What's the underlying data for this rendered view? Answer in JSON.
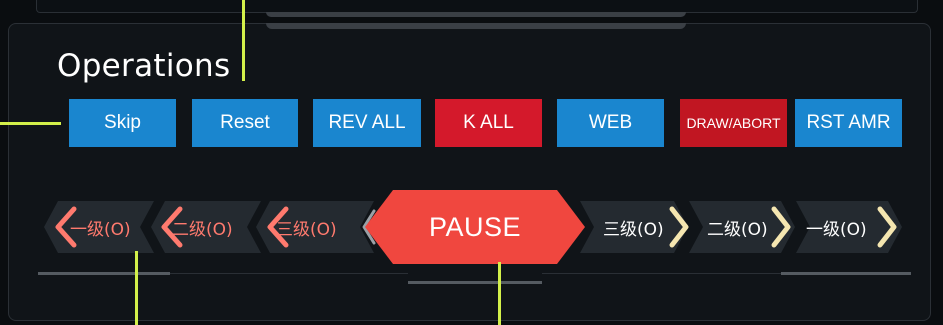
{
  "operations": {
    "title": "Operations",
    "buttons": [
      {
        "label": "Skip",
        "color": "#1a86cf"
      },
      {
        "label": "Reset",
        "color": "#1a86cf"
      },
      {
        "label": "REV ALL",
        "color": "#1a86cf"
      },
      {
        "label": "K ALL",
        "color": "#d4192b"
      },
      {
        "label": "WEB",
        "color": "#1a86cf"
      },
      {
        "label": "DRAW/ABORT",
        "color": "#c11622"
      },
      {
        "label": "RST AMR",
        "color": "#1a86cf"
      }
    ]
  },
  "control": {
    "left_levels": [
      "一级(O)",
      "二级(O)",
      "三级(O)"
    ],
    "pause_label": "PAUSE",
    "right_levels": [
      "三级(O)",
      "二级(O)",
      "一级(O)"
    ]
  },
  "colors": {
    "left_chevron": "#ff7a6e",
    "right_chevron": "#f5e6b0",
    "pause": "#f0473f",
    "callout": "#d3f04a"
  }
}
